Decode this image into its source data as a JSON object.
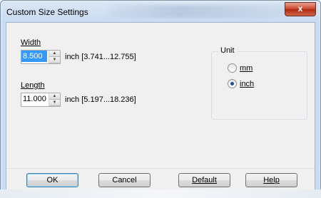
{
  "window": {
    "title": "Custom Size Settings",
    "close_label": "x"
  },
  "width": {
    "label": "Width",
    "value": "8.500",
    "unit_range": "inch [3.741...12.755]"
  },
  "length": {
    "label": "Length",
    "value": "11.000",
    "unit_range": "inch [5.197...18.236]"
  },
  "unit": {
    "title": "Unit",
    "options": [
      {
        "label": "mm",
        "selected": false
      },
      {
        "label": "inch",
        "selected": true
      }
    ]
  },
  "buttons": {
    "ok": "OK",
    "cancel": "Cancel",
    "default": "Default",
    "help": "Help"
  }
}
